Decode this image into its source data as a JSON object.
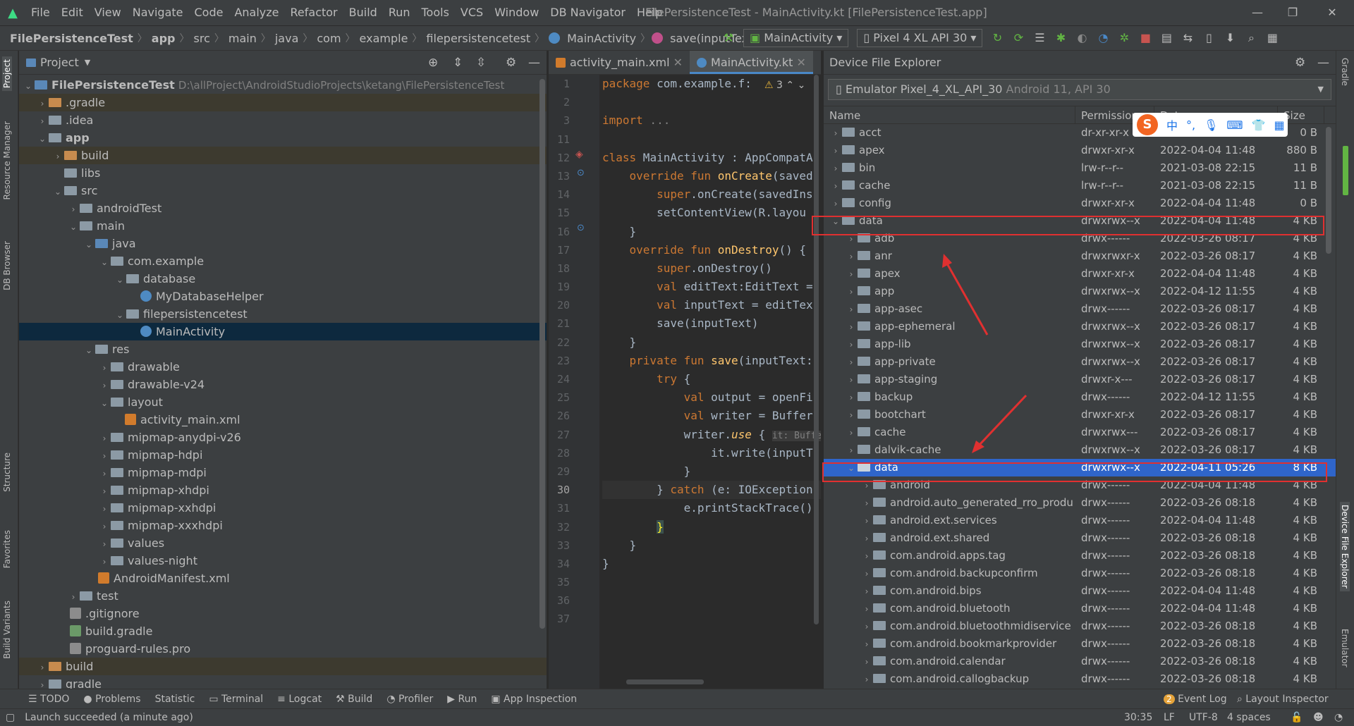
{
  "menu": [
    "File",
    "Edit",
    "View",
    "Navigate",
    "Code",
    "Analyze",
    "Refactor",
    "Build",
    "Run",
    "Tools",
    "VCS",
    "Window",
    "DB Navigator",
    "Help"
  ],
  "window_title": "FilePersistenceTest - MainActivity.kt [FilePersistenceTest.app]",
  "breadcrumb": [
    "FilePersistenceTest",
    "app",
    "src",
    "main",
    "java",
    "com",
    "example",
    "filepersistencetest",
    "MainActivity",
    "save(inputText: String)"
  ],
  "run_config": "MainActivity",
  "device_config": "Pixel 4 XL API 30",
  "left_tools": [
    "Project",
    "Resource Manager",
    "DB Browser",
    "Structure",
    "Favorites",
    "Build Variants"
  ],
  "right_tools": [
    "Gradle",
    "Device File Explorer",
    "Emulator"
  ],
  "project": {
    "title": "Project",
    "root_name": "FilePersistenceTest",
    "root_path": "D:\\allProject\\AndroidStudioProjects\\ketang\\FilePersistenceTest",
    "items": [
      ".gradle",
      ".idea",
      "app",
      "build",
      "libs",
      "src",
      "androidTest",
      "main",
      "java",
      "com.example",
      "database",
      "MyDatabaseHelper",
      "filepersistencetest",
      "MainActivity",
      "res",
      "drawable",
      "drawable-v24",
      "layout",
      "activity_main.xml",
      "mipmap-anydpi-v26",
      "mipmap-hdpi",
      "mipmap-mdpi",
      "mipmap-xhdpi",
      "mipmap-xxhdpi",
      "mipmap-xxxhdpi",
      "values",
      "values-night",
      "AndroidManifest.xml",
      "test",
      ".gitignore",
      "build.gradle",
      "proguard-rules.pro",
      "build",
      "gradle"
    ]
  },
  "editor": {
    "tabs": [
      "activity_main.xml",
      "MainActivity.kt"
    ],
    "line_numbers": [
      "1",
      "2",
      "3",
      "11",
      "12",
      "13",
      "14",
      "15",
      "16",
      "17",
      "18",
      "19",
      "20",
      "21",
      "22",
      "23",
      "24",
      "25",
      "26",
      "27",
      "28",
      "29",
      "30",
      "31",
      "32",
      "33",
      "34",
      "35",
      "36",
      "37"
    ],
    "warning_count": "3",
    "lines": {
      "l1_kw": "package",
      "l1_rest": " com.example.f:",
      "l3_kw": "import",
      "l3_rest": " ...",
      "l12_kw": "class",
      "l12_rest": " MainActivity : AppCompatA",
      "l13_kw": "override fun",
      "l13_fn": " onCreate",
      "l13_rest": "(saved",
      "l14_kw": "super",
      "l14_rest": ".onCreate(savedIns",
      "l15": "setContentView(R.layou",
      "l16": "}",
      "l17_kw": "override fun",
      "l17_fn": " onDestroy",
      "l17_rest": "() {",
      "l18_kw": "super",
      "l18_rest": ".onDestroy()",
      "l19_kw": "val",
      "l19_rest": " editText:EditText =",
      "l20_kw": "val",
      "l20_rest": " inputText = editTex",
      "l21": "save(inputText)",
      "l22": "}",
      "l23_kw": "private fun",
      "l23_fn": " save",
      "l23_rest": "(inputText:",
      "l24_kw": "try",
      "l24_rest": " {",
      "l25_kw": "val",
      "l25_rest": " output = openFi",
      "l26_kw": "val",
      "l26_rest": " writer = Buffer",
      "l27_a": "writer.",
      "l27_b": "use",
      "l27_c": " { ",
      "l27_hint": "it: Buffe",
      "l28": "it.write(inputT",
      "l29": "}",
      "l30_a": "} ",
      "l30_kw": "catch",
      "l30_rest": " (e: IOException",
      "l31": "e.printStackTrace()",
      "l32": "}",
      "l33": "}",
      "l34": "}"
    }
  },
  "dfe": {
    "title": "Device File Explorer",
    "device_name": "Emulator Pixel_4_XL_API_30",
    "device_info": "Android 11, API 30",
    "columns": [
      "Name",
      "Permissions",
      "Date",
      "Size"
    ],
    "rows": [
      {
        "name": "acct",
        "perm": "dr-xr-xr-x",
        "date": "2022-04-04 11:48",
        "size": "0 B"
      },
      {
        "name": "apex",
        "perm": "drwxr-xr-x",
        "date": "2022-04-04 11:48",
        "size": "880 B"
      },
      {
        "name": "bin",
        "perm": "lrw-r--r--",
        "date": "2021-03-08 22:15",
        "size": "11 B"
      },
      {
        "name": "cache",
        "perm": "lrw-r--r--",
        "date": "2021-03-08 22:15",
        "size": "11 B"
      },
      {
        "name": "config",
        "perm": "drwxr-xr-x",
        "date": "2022-04-04 11:48",
        "size": "0 B"
      },
      {
        "name": "data",
        "perm": "drwxrwx--x",
        "date": "2022-04-04 11:48",
        "size": "4 KB"
      },
      {
        "name": "adb",
        "perm": "drwx------",
        "date": "2022-03-26 08:17",
        "size": "4 KB"
      },
      {
        "name": "anr",
        "perm": "drwxrwxr-x",
        "date": "2022-03-26 08:17",
        "size": "4 KB"
      },
      {
        "name": "apex",
        "perm": "drwxr-xr-x",
        "date": "2022-04-04 11:48",
        "size": "4 KB"
      },
      {
        "name": "app",
        "perm": "drwxrwx--x",
        "date": "2022-04-12 11:55",
        "size": "4 KB"
      },
      {
        "name": "app-asec",
        "perm": "drwx------",
        "date": "2022-03-26 08:17",
        "size": "4 KB"
      },
      {
        "name": "app-ephemeral",
        "perm": "drwxrwx--x",
        "date": "2022-03-26 08:17",
        "size": "4 KB"
      },
      {
        "name": "app-lib",
        "perm": "drwxrwx--x",
        "date": "2022-03-26 08:17",
        "size": "4 KB"
      },
      {
        "name": "app-private",
        "perm": "drwxrwx--x",
        "date": "2022-03-26 08:17",
        "size": "4 KB"
      },
      {
        "name": "app-staging",
        "perm": "drwxr-x---",
        "date": "2022-03-26 08:17",
        "size": "4 KB"
      },
      {
        "name": "backup",
        "perm": "drwx------",
        "date": "2022-04-12 11:55",
        "size": "4 KB"
      },
      {
        "name": "bootchart",
        "perm": "drwxr-xr-x",
        "date": "2022-03-26 08:17",
        "size": "4 KB"
      },
      {
        "name": "cache",
        "perm": "drwxrwx---",
        "date": "2022-03-26 08:17",
        "size": "4 KB"
      },
      {
        "name": "dalvik-cache",
        "perm": "drwxrwx--x",
        "date": "2022-03-26 08:17",
        "size": "4 KB"
      },
      {
        "name": "data",
        "perm": "drwxrwx--x",
        "date": "2022-04-11 05:26",
        "size": "8 KB"
      },
      {
        "name": "android",
        "perm": "drwx------",
        "date": "2022-04-04 11:48",
        "size": "4 KB"
      },
      {
        "name": "android.auto_generated_rro_produ",
        "perm": "drwx------",
        "date": "2022-03-26 08:18",
        "size": "4 KB"
      },
      {
        "name": "android.ext.services",
        "perm": "drwx------",
        "date": "2022-04-04 11:48",
        "size": "4 KB"
      },
      {
        "name": "android.ext.shared",
        "perm": "drwx------",
        "date": "2022-03-26 08:18",
        "size": "4 KB"
      },
      {
        "name": "com.android.apps.tag",
        "perm": "drwx------",
        "date": "2022-03-26 08:18",
        "size": "4 KB"
      },
      {
        "name": "com.android.backupconfirm",
        "perm": "drwx------",
        "date": "2022-03-26 08:18",
        "size": "4 KB"
      },
      {
        "name": "com.android.bips",
        "perm": "drwx------",
        "date": "2022-04-04 11:48",
        "size": "4 KB"
      },
      {
        "name": "com.android.bluetooth",
        "perm": "drwx------",
        "date": "2022-04-04 11:48",
        "size": "4 KB"
      },
      {
        "name": "com.android.bluetoothmidiservice",
        "perm": "drwx------",
        "date": "2022-03-26 08:18",
        "size": "4 KB"
      },
      {
        "name": "com.android.bookmarkprovider",
        "perm": "drwx------",
        "date": "2022-03-26 08:18",
        "size": "4 KB"
      },
      {
        "name": "com.android.calendar",
        "perm": "drwx------",
        "date": "2022-03-26 08:18",
        "size": "4 KB"
      },
      {
        "name": "com.android.callogbackup",
        "perm": "drwx------",
        "date": "2022-03-26 08:18",
        "size": "4 KB"
      }
    ]
  },
  "ime": {
    "logo": "S",
    "mode": "中"
  },
  "bottom_tools": [
    "TODO",
    "Problems",
    "Statistic",
    "Terminal",
    "Logcat",
    "Build",
    "Profiler",
    "Run",
    "App Inspection"
  ],
  "event_log": "Event Log",
  "event_count": "2",
  "layout_inspector": "Layout Inspector",
  "status": {
    "message": "Launch succeeded (a minute ago)",
    "position": "30:35",
    "line_sep": "LF",
    "encoding": "UTF-8",
    "indent": "4 spaces"
  }
}
